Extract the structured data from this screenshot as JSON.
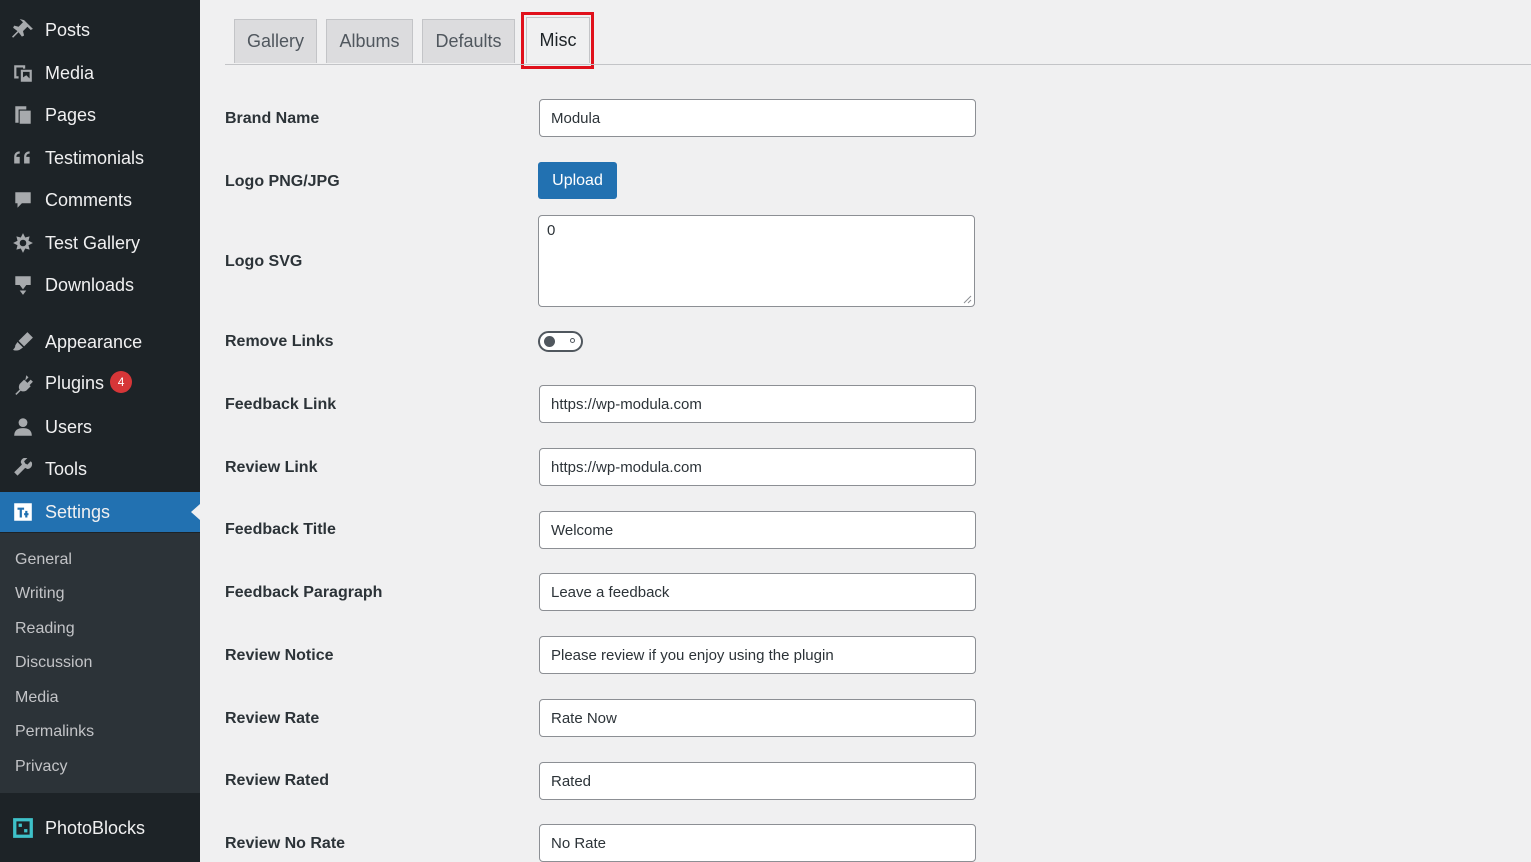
{
  "sidebar": {
    "items": [
      {
        "label": "Posts",
        "icon": "pin-icon"
      },
      {
        "label": "Media",
        "icon": "media-icon"
      },
      {
        "label": "Pages",
        "icon": "pages-icon"
      },
      {
        "label": "Testimonials",
        "icon": "quote-icon"
      },
      {
        "label": "Comments",
        "icon": "comment-icon"
      },
      {
        "label": "Test Gallery",
        "icon": "gallery-icon"
      },
      {
        "label": "Downloads",
        "icon": "download-icon"
      },
      {
        "label": "Appearance",
        "icon": "brush-icon"
      },
      {
        "label": "Plugins",
        "icon": "plugin-icon",
        "badge": "4"
      },
      {
        "label": "Users",
        "icon": "user-icon"
      },
      {
        "label": "Tools",
        "icon": "wrench-icon"
      },
      {
        "label": "Settings",
        "icon": "settings-icon",
        "active": true
      },
      {
        "label": "PhotoBlocks",
        "icon": "photoblocks-icon"
      }
    ],
    "submenu": [
      "General",
      "Writing",
      "Reading",
      "Discussion",
      "Media",
      "Permalinks",
      "Privacy"
    ],
    "accent_color": "#2271b1"
  },
  "tabs": [
    {
      "label": "Gallery"
    },
    {
      "label": "Albums"
    },
    {
      "label": "Defaults"
    },
    {
      "label": "Misc",
      "active": true,
      "highlighted": true
    }
  ],
  "form": {
    "brand_name": {
      "label": "Brand Name",
      "value": "Modula"
    },
    "logo_png": {
      "label": "Logo PNG/JPG",
      "button": "Upload"
    },
    "logo_svg": {
      "label": "Logo SVG",
      "value": "0"
    },
    "remove_links": {
      "label": "Remove Links",
      "enabled": false
    },
    "feedback_link": {
      "label": "Feedback Link",
      "value": "https://wp-modula.com"
    },
    "review_link": {
      "label": "Review Link",
      "value": "https://wp-modula.com"
    },
    "feedback_title": {
      "label": "Feedback Title",
      "value": "Welcome"
    },
    "feedback_paragraph": {
      "label": "Feedback Paragraph",
      "value": "Leave a feedback"
    },
    "review_notice": {
      "label": "Review Notice",
      "value": "Please review if you enjoy using the plugin"
    },
    "review_rate": {
      "label": "Review Rate",
      "value": "Rate Now"
    },
    "review_rated": {
      "label": "Review Rated",
      "value": "Rated"
    },
    "review_no_rate": {
      "label": "Review No Rate",
      "value": "No Rate"
    }
  }
}
